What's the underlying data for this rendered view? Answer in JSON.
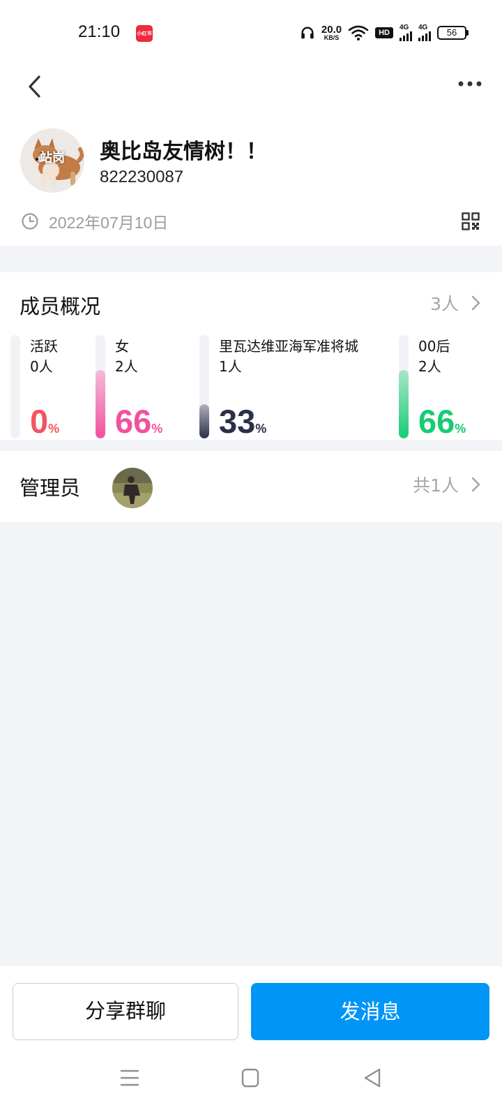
{
  "status_bar": {
    "time": "21:10",
    "app_badge": "小红书",
    "speed_value": "20.0",
    "speed_unit": "KB/S",
    "hd_label": "HD",
    "network_1": "4G",
    "network_2": "4G",
    "battery": "56",
    "icons": [
      "headphones-icon",
      "wifi-icon",
      "hd-icon",
      "signal-icon",
      "battery-icon"
    ]
  },
  "header": {
    "back_icon": "chevron-left-icon",
    "more_icon": "more-horizontal-icon"
  },
  "profile": {
    "avatar_text": "站岗",
    "name": "奥比岛友情树！！",
    "id": "822230087",
    "created_date": "2022年07月10日",
    "date_icon": "clock-icon",
    "qr_icon": "qr-code-icon"
  },
  "members": {
    "title": "成员概况",
    "count": "3人",
    "stats": [
      {
        "label": "活跃",
        "count": "0人",
        "percent": "0",
        "percent_sign": "%",
        "fraction": 0.0,
        "color": "#f2555f"
      },
      {
        "label": "女",
        "count": "2人",
        "percent": "66",
        "percent_sign": "%",
        "fraction": 0.66,
        "color": "#f2509f"
      },
      {
        "label": "里瓦达维亚海军准将城",
        "count": "1人",
        "percent": "33",
        "percent_sign": "%",
        "fraction": 0.33,
        "color": "#2b2f48"
      },
      {
        "label": "00后",
        "count": "2人",
        "percent": "66",
        "percent_sign": "%",
        "fraction": 0.66,
        "color": "#17cc74"
      }
    ]
  },
  "admins": {
    "title": "管理员",
    "count": "共1人"
  },
  "actions": {
    "share_label": "分享群聊",
    "send_label": "发消息"
  },
  "colors": {
    "primary": "#0095f6",
    "muted_text": "#a4a6ad",
    "background": "#f3f4f8"
  },
  "navbar": {
    "icons": [
      "menu-icon",
      "home-icon",
      "back-triangle-icon"
    ]
  }
}
